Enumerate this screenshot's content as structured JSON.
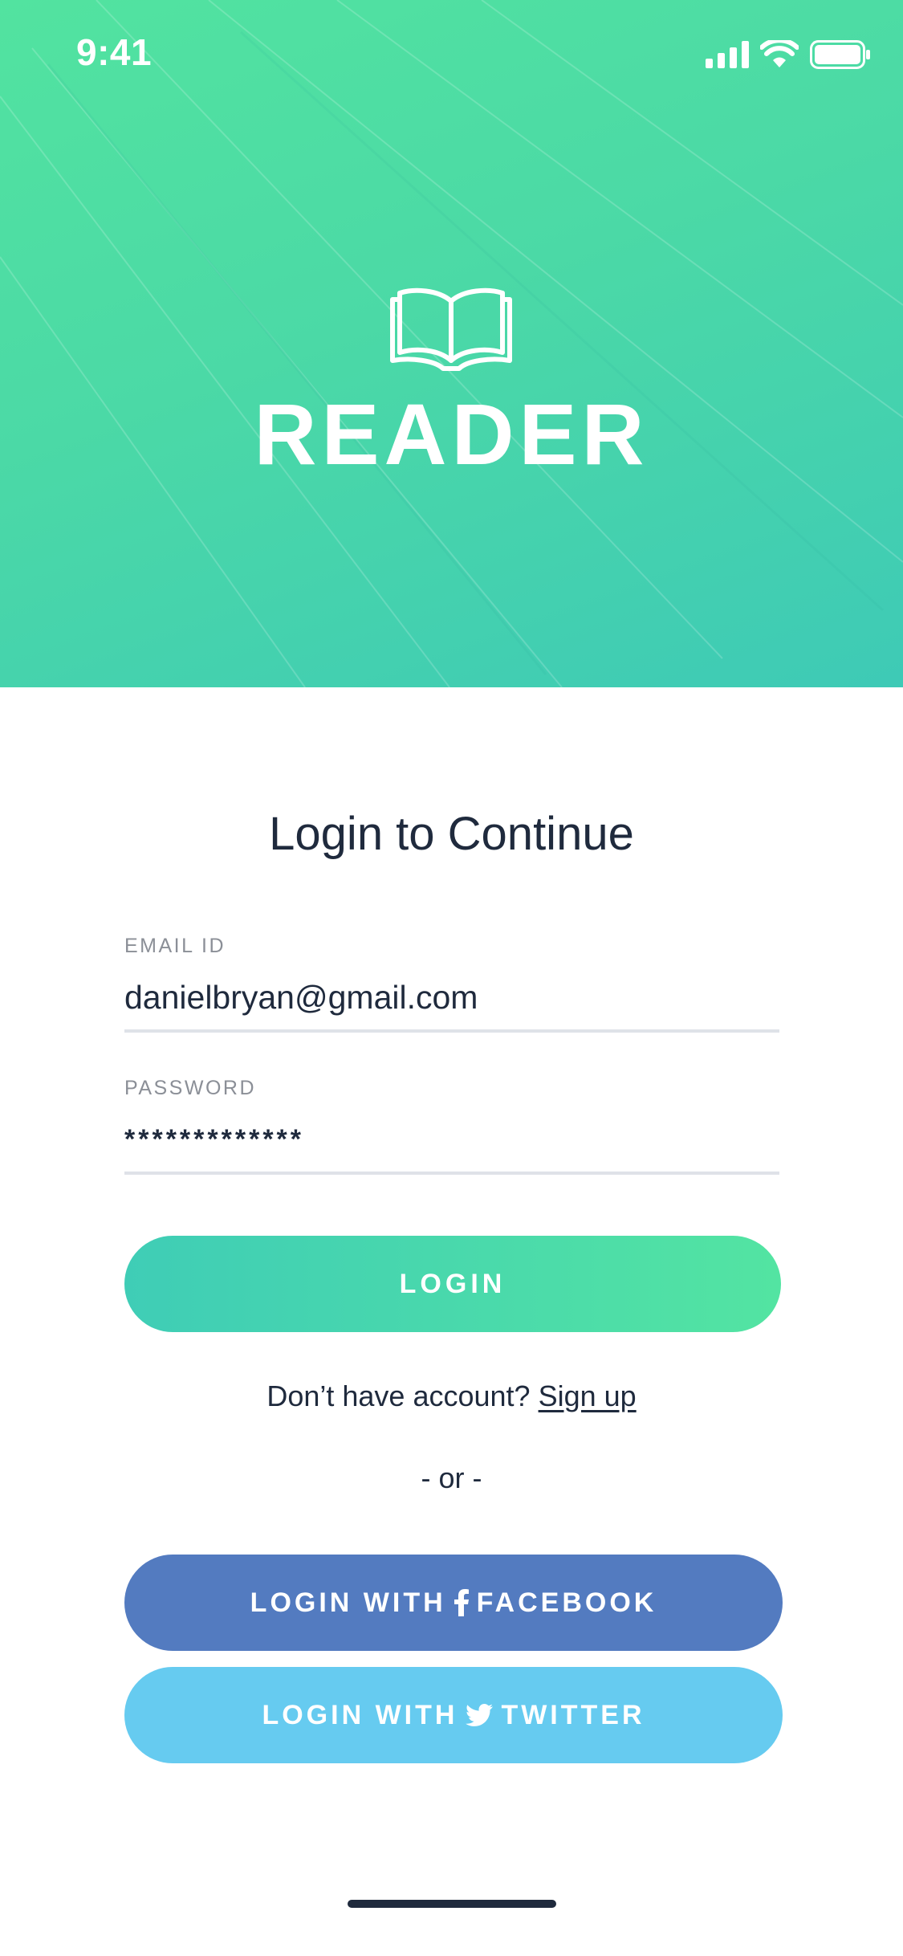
{
  "status_bar": {
    "time": "9:41",
    "icons": [
      "cellular-signal-icon",
      "wifi-icon",
      "battery-icon"
    ]
  },
  "header": {
    "logo_icon": "open-book-icon",
    "app_name": "READER"
  },
  "form": {
    "title": "Login to Continue",
    "email": {
      "label": "EMAIL ID",
      "value": "danielbryan@gmail.com"
    },
    "password": {
      "label": "PASSWORD",
      "value": "*************"
    },
    "login_label": "LOGIN",
    "signup_prompt": "Don’t have account?",
    "signup_link": "Sign up",
    "or_divider": "- or -"
  },
  "social": {
    "facebook": {
      "prefix": "LOGIN WITH",
      "icon": "facebook-icon",
      "name": "FACEBOOK"
    },
    "twitter": {
      "prefix": "LOGIN WITH",
      "icon": "twitter-bird-icon",
      "name": "TWITTER"
    }
  },
  "colors": {
    "brand_green": "#53e4a2",
    "brand_teal": "#3fcdb6",
    "facebook_blue": "#537bc0",
    "twitter_blue": "#66cbf0",
    "text_dark": "#1f2a3d",
    "label_gray": "#8b8f97"
  }
}
